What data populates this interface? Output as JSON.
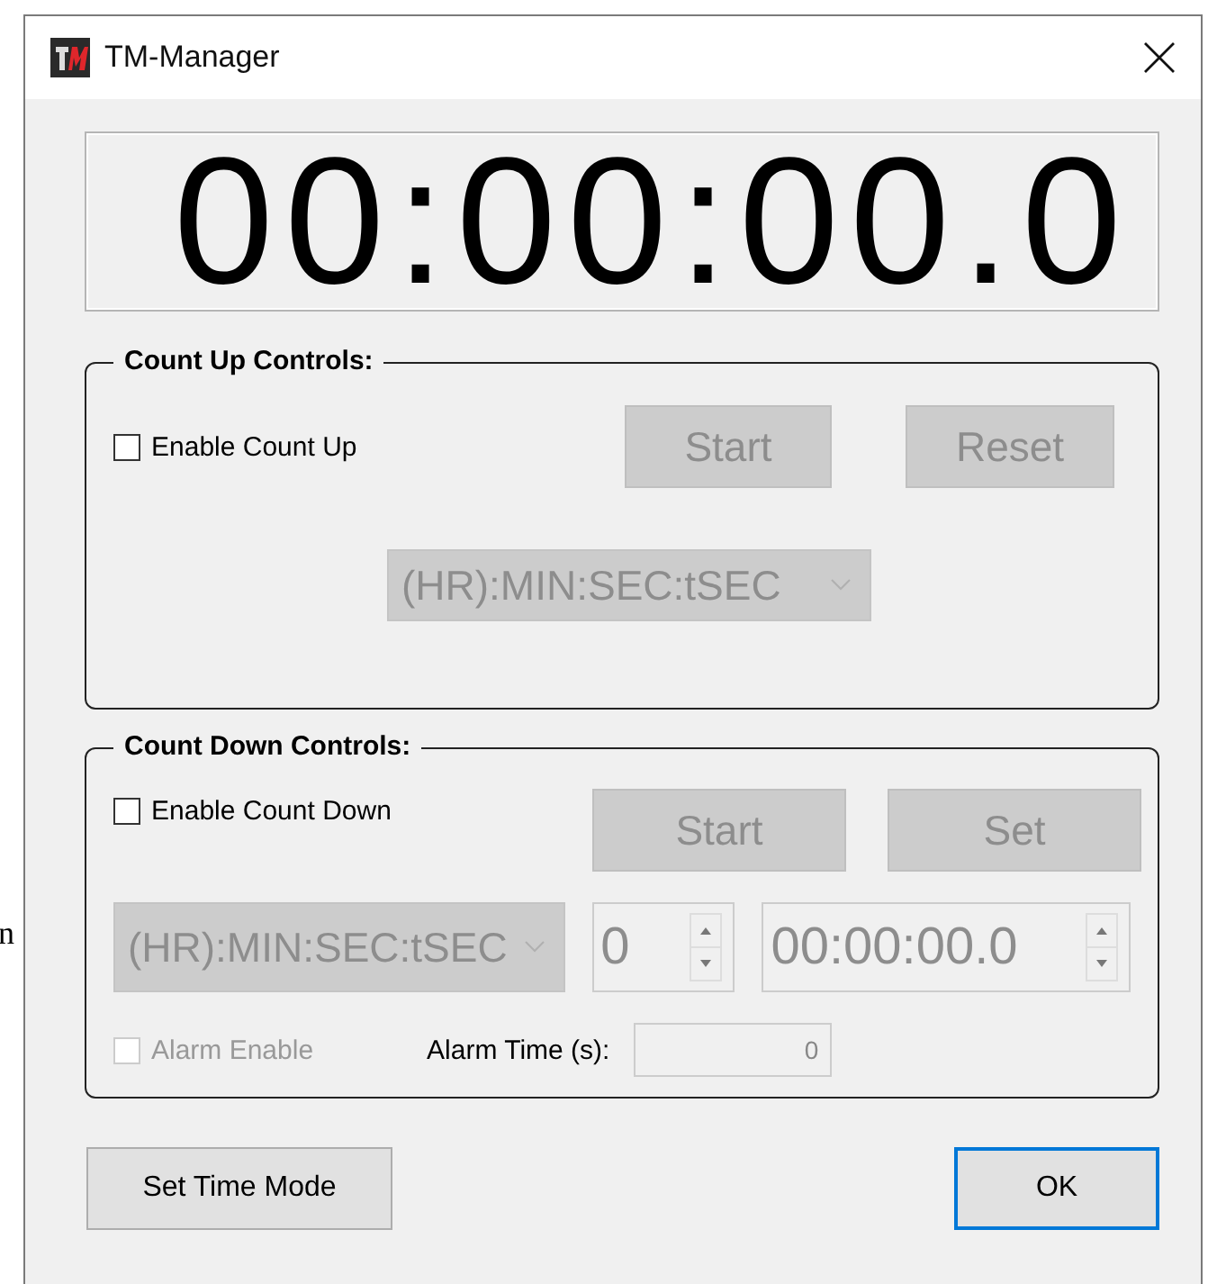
{
  "window": {
    "title": "TM-Manager"
  },
  "background_text": "n",
  "display": {
    "time": "00:00:00.0"
  },
  "count_up": {
    "title": "Count Up Controls:",
    "enable": {
      "label": "Enable Count Up",
      "checked": false
    },
    "buttons": [
      {
        "label": "Start",
        "disabled": true
      },
      {
        "label": "Reset",
        "disabled": true
      }
    ],
    "format": {
      "value": "(HR):MIN:SEC:tSEC",
      "disabled": true
    }
  },
  "count_down": {
    "title": "Count Down Controls:",
    "enable": {
      "label": "Enable Count Down",
      "checked": false
    },
    "buttons": [
      {
        "label": "Start",
        "disabled": true
      },
      {
        "label": "Set",
        "disabled": true
      }
    ],
    "format": {
      "value": "(HR):MIN:SEC:tSEC",
      "disabled": true
    },
    "days": {
      "value": "0",
      "disabled": true
    },
    "time": {
      "value": "00:00:00.0",
      "disabled": true
    },
    "alarm": {
      "label": "Alarm Enable",
      "checked": false,
      "disabled": true
    },
    "alarm_time": {
      "label": "Alarm Time (s):",
      "value": "0",
      "disabled": true
    }
  },
  "buttons": [
    {
      "label": "Set Time Mode",
      "default": false
    },
    {
      "label": "OK",
      "default": true
    }
  ]
}
